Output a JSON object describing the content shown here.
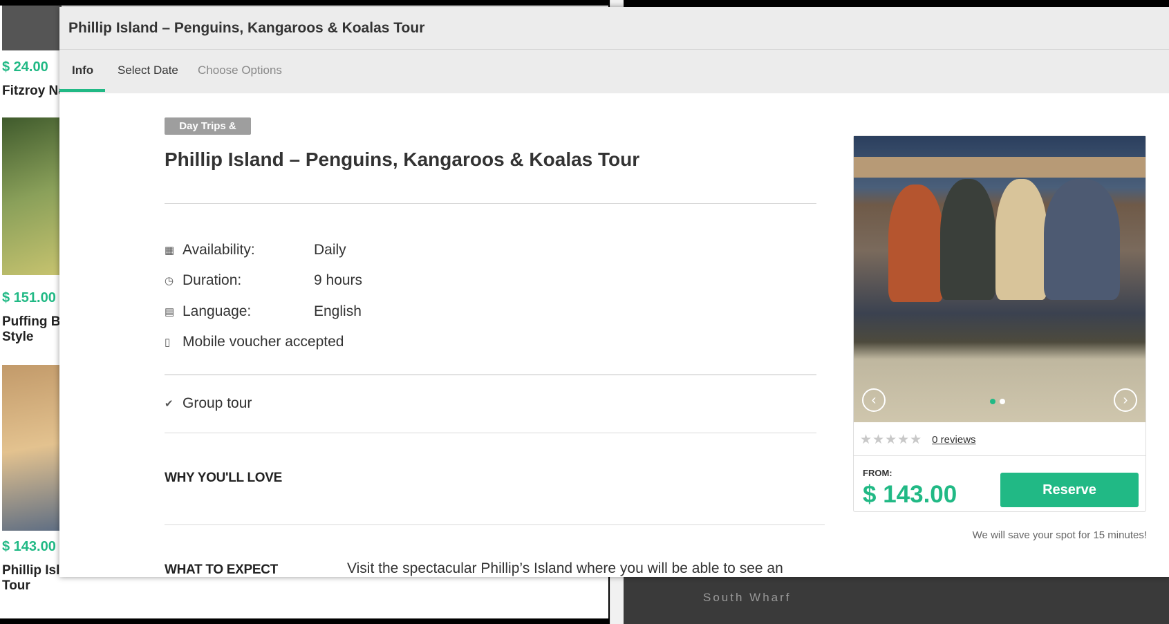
{
  "background": {
    "items": [
      {
        "price": "$ 24.00",
        "title": "Fitzroy Na"
      },
      {
        "price": "$ 151.00",
        "title_line1": "Puffing Bil",
        "title_line2": "Style"
      },
      {
        "price": "$ 143.00",
        "title_line1": "Phillip Isla",
        "title_line2": "Tour"
      }
    ],
    "map_label": "South Wharf"
  },
  "modal": {
    "title": "Phillip Island – Penguins, Kangaroos & Koalas Tour",
    "tabs": [
      {
        "label": "Info"
      },
      {
        "label": "Select Date"
      },
      {
        "label": "Choose Options"
      }
    ]
  },
  "details": {
    "category_badge": "Day Trips &",
    "tour_title": "Phillip Island – Penguins, Kangaroos & Koalas Tour",
    "availability_label": "Availability:",
    "availability_value": "Daily",
    "duration_label": "Duration:",
    "duration_value": "9 hours",
    "language_label": "Language:",
    "language_value": "English",
    "voucher_text": "Mobile voucher accepted",
    "group_text": "Group tour",
    "why_heading": "WHY YOU'LL LOVE",
    "expect_heading": "WHAT TO EXPECT",
    "expect_text": "Visit the spectacular Phillip’s Island where you will be able to see an"
  },
  "booking": {
    "stars": "★★★★★",
    "reviews": "0 reviews",
    "from_label": "FROM:",
    "price": "$ 143.00",
    "reserve_label": "Reserve",
    "save_note": "We will save your spot for 15 minutes!"
  },
  "colors": {
    "accent": "#21b985"
  },
  "icons": {
    "availability": "calendar-icon",
    "duration": "clock-icon",
    "language": "speech-bubble-icon",
    "voucher": "mobile-phone-icon",
    "group": "checkmark-icon",
    "prev": "chevron-left-icon",
    "next": "chevron-right-icon"
  }
}
